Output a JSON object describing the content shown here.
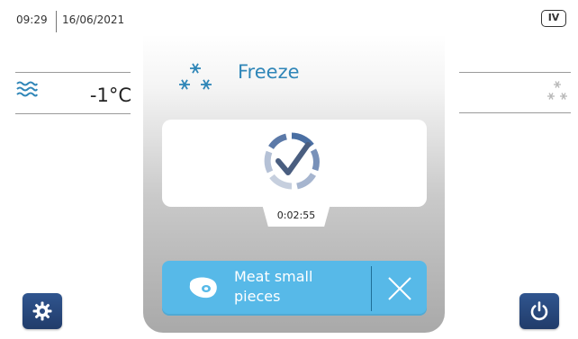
{
  "status_bar": {
    "time": "09:29",
    "date": "16/06/2021",
    "badge": "IV"
  },
  "left_panel": {
    "temperature": "-1°C",
    "icon": "air-flow-waves-icon"
  },
  "right_panel": {
    "icon": "snowflakes-gray-icon"
  },
  "cycle": {
    "title": "Freeze",
    "icon": "snowflakes-icon",
    "status_icon": "check-cycle-icon",
    "elapsed": "0:02:55"
  },
  "program": {
    "label_line1": "Meat small",
    "label_line2": "pieces",
    "icon": "meat-steak-icon",
    "close_icon": "close-x-icon"
  },
  "buttons": {
    "settings_icon": "gear-icon",
    "power_icon": "power-icon"
  },
  "colors": {
    "accent": "#2f86b8",
    "program_bg": "#57b9e8",
    "button_bg": "#2a4a7f"
  }
}
